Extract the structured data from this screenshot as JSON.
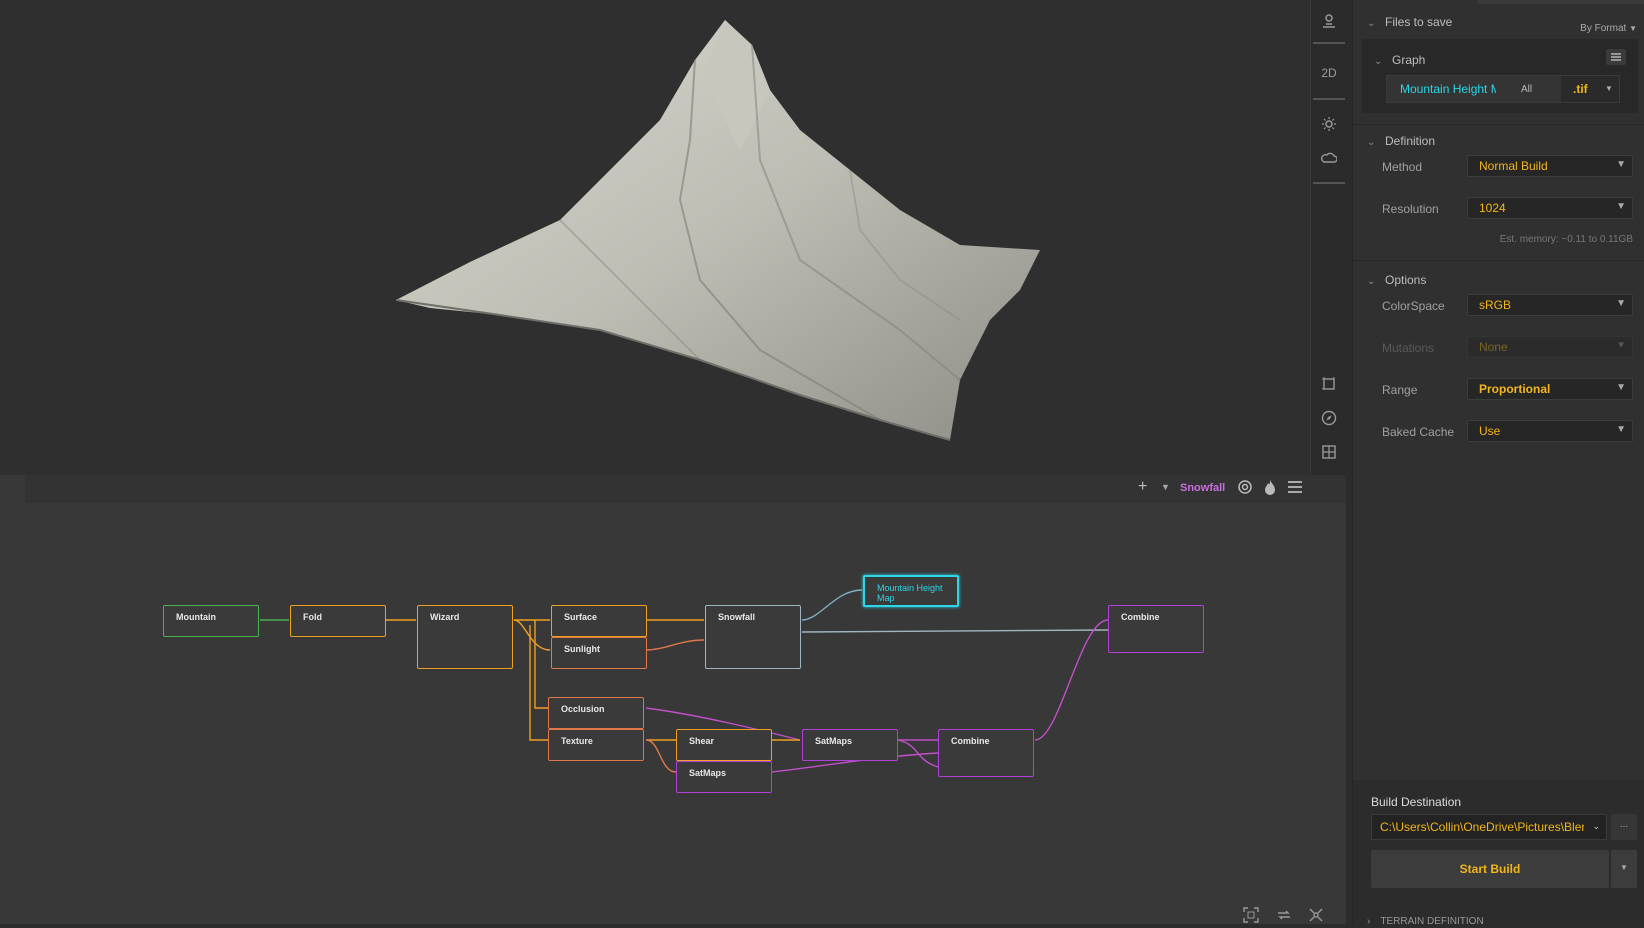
{
  "toolbar": {
    "btn_2d": "2D"
  },
  "graph_toolbar": {
    "active_node": "Snowfall"
  },
  "nodes": {
    "mountain": "Mountain",
    "fold": "Fold",
    "wizard": "Wizard",
    "surface": "Surface",
    "sunlight": "Sunlight",
    "snowfall": "Snowfall",
    "mountain_height_map": "Mountain Height Map",
    "combine_top": "Combine",
    "occlusion": "Occlusion",
    "texture": "Texture",
    "shear": "Shear",
    "satmaps_a": "SatMaps",
    "satmaps_b": "SatMaps",
    "combine_bottom": "Combine"
  },
  "panel": {
    "files_to_save": {
      "title": "Files to save",
      "by_format": "By Format"
    },
    "graph": {
      "title": "Graph",
      "file_name": "Mountain Height M",
      "all": "All",
      "ext": ".tif"
    },
    "definition": {
      "title": "Definition",
      "method_label": "Method",
      "method_value": "Normal Build",
      "resolution_label": "Resolution",
      "resolution_value": "1024",
      "est_memory": "Est. memory: ~0.11 to 0.11GB"
    },
    "options": {
      "title": "Options",
      "colorspace_label": "ColorSpace",
      "colorspace_value": "sRGB",
      "mutations_label": "Mutations",
      "mutations_value": "None",
      "range_label": "Range",
      "range_value": "Proportional",
      "baked_label": "Baked Cache",
      "baked_value": "Use"
    },
    "build": {
      "title": "Build Destination",
      "path": "C:\\Users\\Collin\\OneDrive\\Pictures\\Blend",
      "browse": "...",
      "start": "Start Build"
    },
    "terrain": "TERRAIN DEFINITION"
  },
  "colors": {
    "accent": "#f2b61c",
    "cyan": "#2dd6e6",
    "purple": "#b040d8",
    "orange": "#f0a020",
    "green": "#4caf50"
  }
}
